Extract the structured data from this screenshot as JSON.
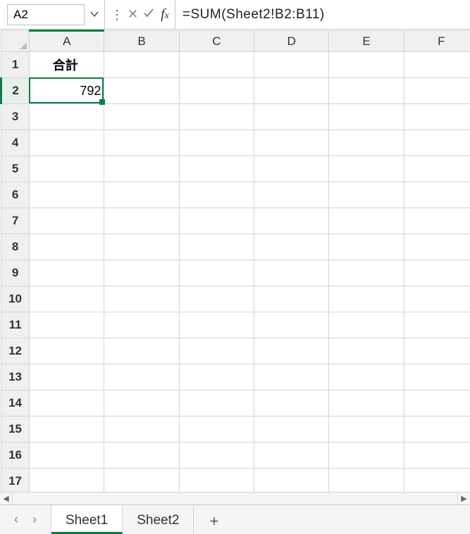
{
  "formula_bar": {
    "cell_ref": "A2",
    "formula": "=SUM(Sheet2!B2:B11)"
  },
  "columns": [
    "A",
    "B",
    "C",
    "D",
    "E",
    "F"
  ],
  "row_count": 17,
  "cells": {
    "A1": "合計",
    "A2": "792"
  },
  "selection": {
    "cell": "A2",
    "row": 2,
    "col": "A"
  },
  "sheet_tabs": {
    "tabs": [
      "Sheet1",
      "Sheet2"
    ],
    "active": "Sheet1"
  }
}
